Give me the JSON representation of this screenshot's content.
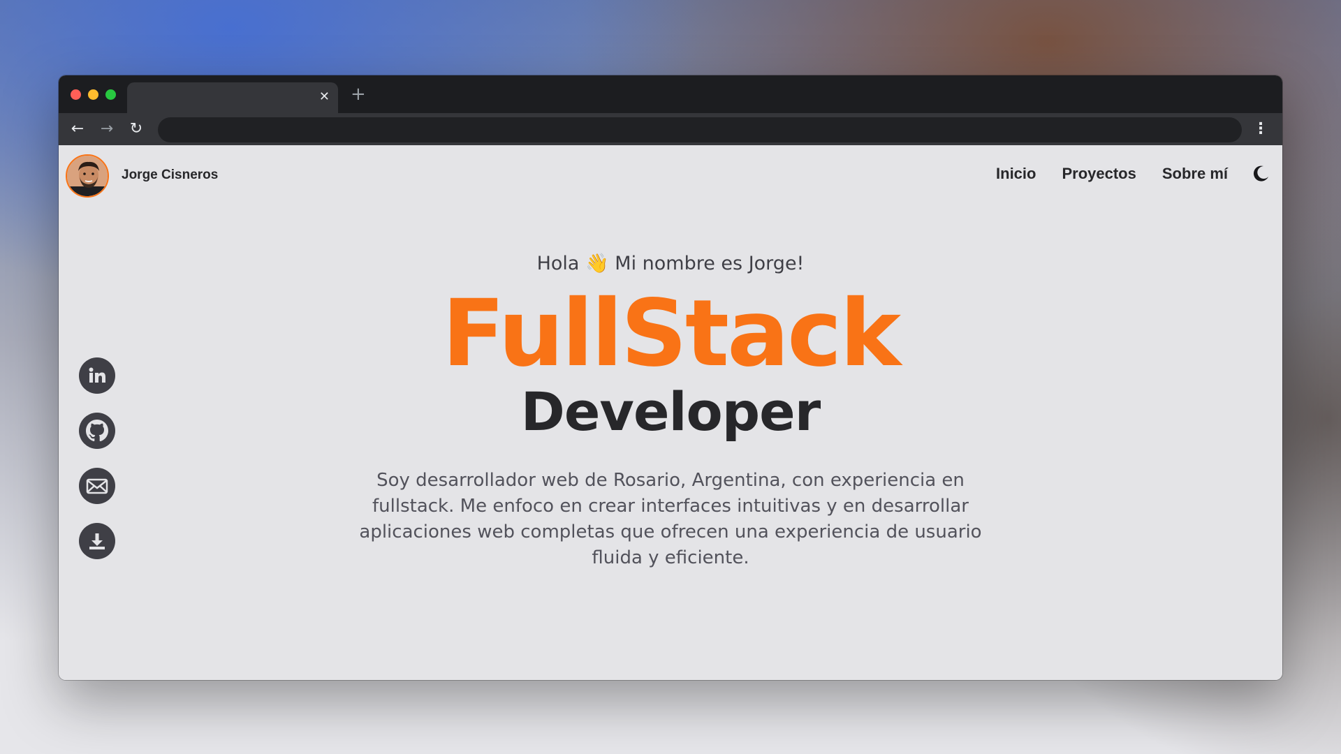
{
  "browser": {
    "tab_close_glyph": "✕",
    "new_tab_glyph": "+",
    "back_glyph": "←",
    "forward_glyph": "→",
    "reload_glyph": "↻",
    "menu_glyph": "⋮"
  },
  "header": {
    "name": "Jorge Cisneros",
    "nav": [
      "Inicio",
      "Proyectos",
      "Sobre mí"
    ],
    "theme_icon": "moon-icon"
  },
  "socials": [
    "linkedin-icon",
    "github-icon",
    "mail-icon",
    "download-icon"
  ],
  "hero": {
    "greeting_before": "Hola",
    "greeting_emoji": "👋",
    "greeting_after": "Mi nombre es Jorge!",
    "title": "FullStack",
    "subtitle": "Developer",
    "description": "Soy desarrollador web de Rosario, Argentina, con experiencia en fullstack. Me enfoco en crear interfaces intuitivas y en desarrollar aplicaciones web completas que ofrecen una experiencia de usuario fluida y eficiente."
  },
  "colors": {
    "accent": "#f97316",
    "text_dark": "#27272a",
    "page_bg": "#e4e4e7",
    "icon_bg": "#3f3f46"
  }
}
